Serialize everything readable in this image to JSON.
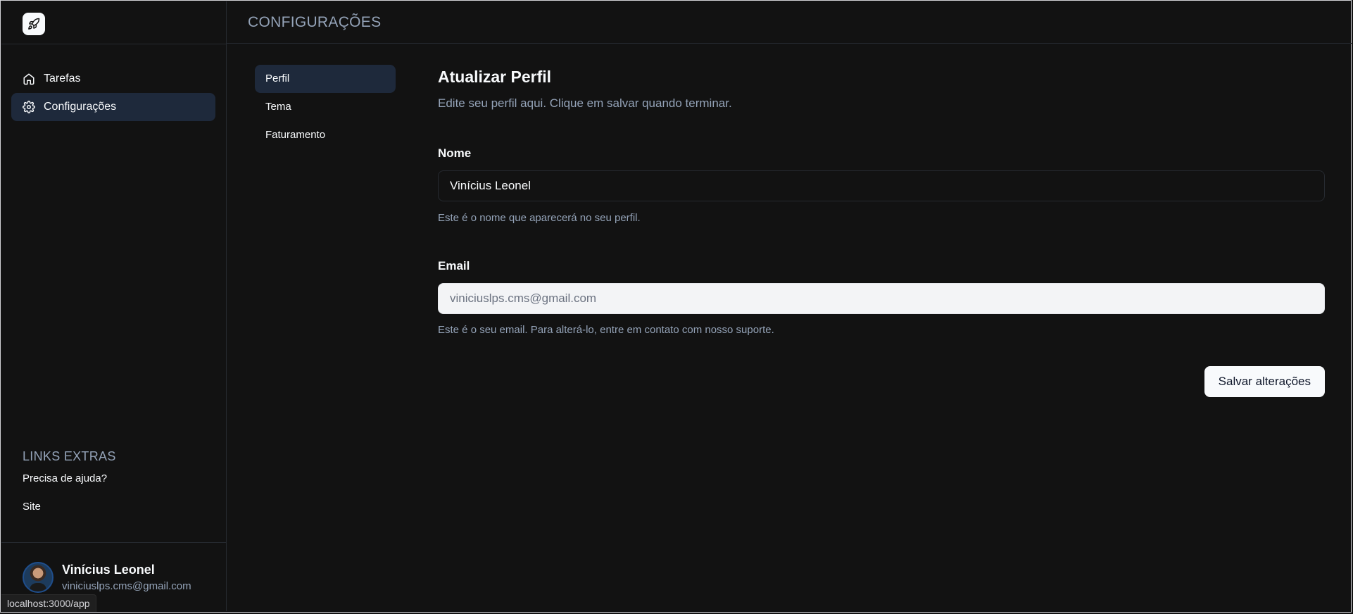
{
  "sidebar": {
    "logo_icon": "rocket-icon",
    "nav": [
      {
        "label": "Tarefas",
        "icon": "home-icon",
        "active": false
      },
      {
        "label": "Configurações",
        "icon": "gear-icon",
        "active": true
      }
    ],
    "extras_title": "LINKS EXTRAS",
    "extras": [
      "Precisa de ajuda?",
      "Site"
    ],
    "user": {
      "name": "Vinícius Leonel",
      "email": "viniciuslps.cms@gmail.com"
    }
  },
  "header": {
    "title": "CONFIGURAÇÕES"
  },
  "settings_nav": [
    "Perfil",
    "Tema",
    "Faturamento"
  ],
  "form": {
    "title": "Atualizar Perfil",
    "description": "Edite seu perfil aqui. Clique em salvar quando terminar.",
    "name_label": "Nome",
    "name_value": "Vinícius Leonel",
    "name_hint": "Este é o nome que aparecerá no seu perfil.",
    "email_label": "Email",
    "email_value": "viniciuslps.cms@gmail.com",
    "email_hint": "Este é o seu email. Para alterá-lo, entre em contato com nosso suporte.",
    "save_label": "Salvar alterações"
  },
  "status_bar": "localhost:3000/app"
}
